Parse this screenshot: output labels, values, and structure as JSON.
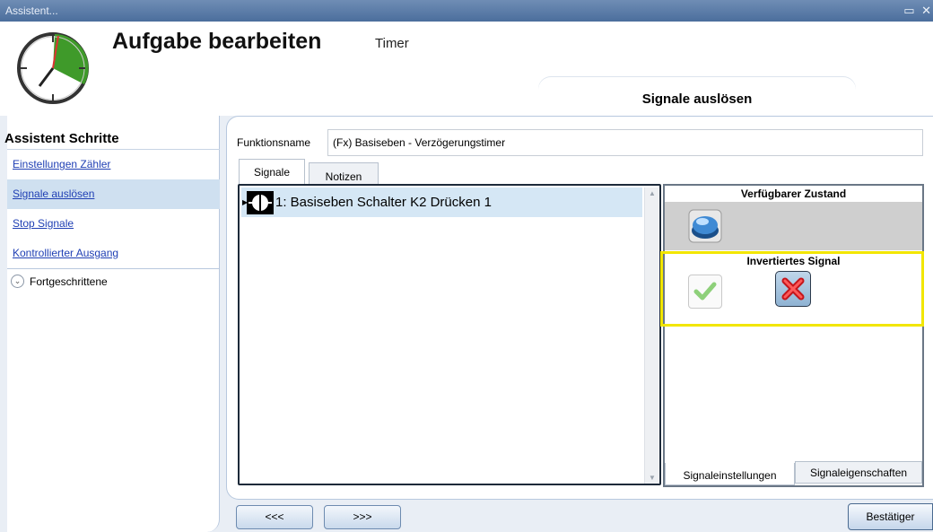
{
  "window": {
    "title": "Assistent...",
    "controls": "▭ ✕"
  },
  "header": {
    "title": "Aufgabe bearbeiten",
    "subtitle": "Timer",
    "step_tab": "Signale auslösen"
  },
  "sidebar": {
    "title": "Assistent Schritte",
    "items": [
      {
        "label": "Einstellungen Zähler",
        "active": false
      },
      {
        "label": "Signale auslösen",
        "active": true
      },
      {
        "label": "Stop Signale",
        "active": false
      },
      {
        "label": "Kontrollierter Ausgang",
        "active": false
      }
    ],
    "expander": {
      "label": "Fortgeschrittene",
      "icon": "chevron-down-icon"
    }
  },
  "main": {
    "function_name_label": "Funktionsname",
    "function_name_value": "(Fx) Basiseben - Verzögerungstimer",
    "tabs": [
      {
        "label": "Signale",
        "active": true
      },
      {
        "label": "Notizen",
        "active": false
      }
    ],
    "signals": [
      {
        "label": "1: Basiseben Schalter K2 Drücken 1",
        "icon": "push-button-signal-icon",
        "selected": true
      }
    ],
    "right_panel": {
      "available_state_label": "Verfügbarer Zustand",
      "available_state_icon": "blue-push-button-icon",
      "inverted_signal_label": "Invertiertes Signal",
      "inverted_yes_icon": "checkmark-icon",
      "inverted_no_icon": "x-icon",
      "inverted_selected": "no",
      "highlight_color": "#f2e600",
      "tabs": [
        {
          "label": "Signaleinstellungen",
          "active": true
        },
        {
          "label": "Signaleigenschaften",
          "active": false
        }
      ]
    }
  },
  "footer": {
    "back_label": "<<<",
    "forward_label": ">>>",
    "confirm_label": "Bestätiger"
  }
}
